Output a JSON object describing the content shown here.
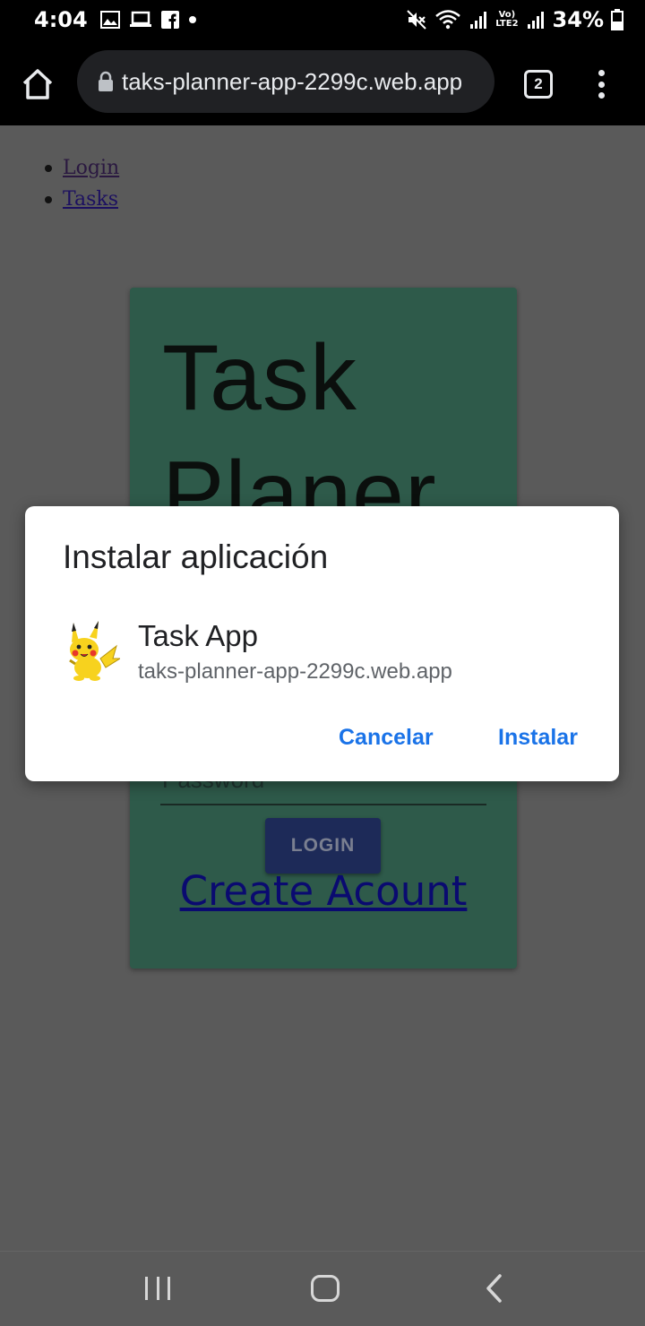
{
  "status_bar": {
    "time": "4:04",
    "battery": "34%",
    "left_icons": [
      "image-icon",
      "laptop-icon",
      "facebook-icon",
      "dot-icon"
    ],
    "right_icons": [
      "mute-icon",
      "wifi-icon",
      "signal-icon",
      "volte-lte2-icon",
      "signal-icon",
      "battery-icon"
    ],
    "volte_label": "Vo)",
    "lte_label": "LTE2"
  },
  "browser": {
    "url": "taks-planner-app-2299c.web.app",
    "tab_count": "2"
  },
  "page": {
    "nav_links": [
      "Login",
      "Tasks"
    ],
    "card": {
      "title": "Task Planer",
      "password_placeholder": "Password",
      "login_label": "LOGIN",
      "create_account_label": "Create Acount"
    },
    "colors": {
      "card_bg": "#2e5a4a",
      "login_bg": "#1d2a58",
      "overlay": "#5a5a5a"
    }
  },
  "dialog": {
    "title": "Instalar aplicación",
    "app_name": "Task App",
    "app_url": "taks-planner-app-2299c.web.app",
    "cancel_label": "Cancelar",
    "install_label": "Instalar",
    "accent": "#1a73e8"
  }
}
